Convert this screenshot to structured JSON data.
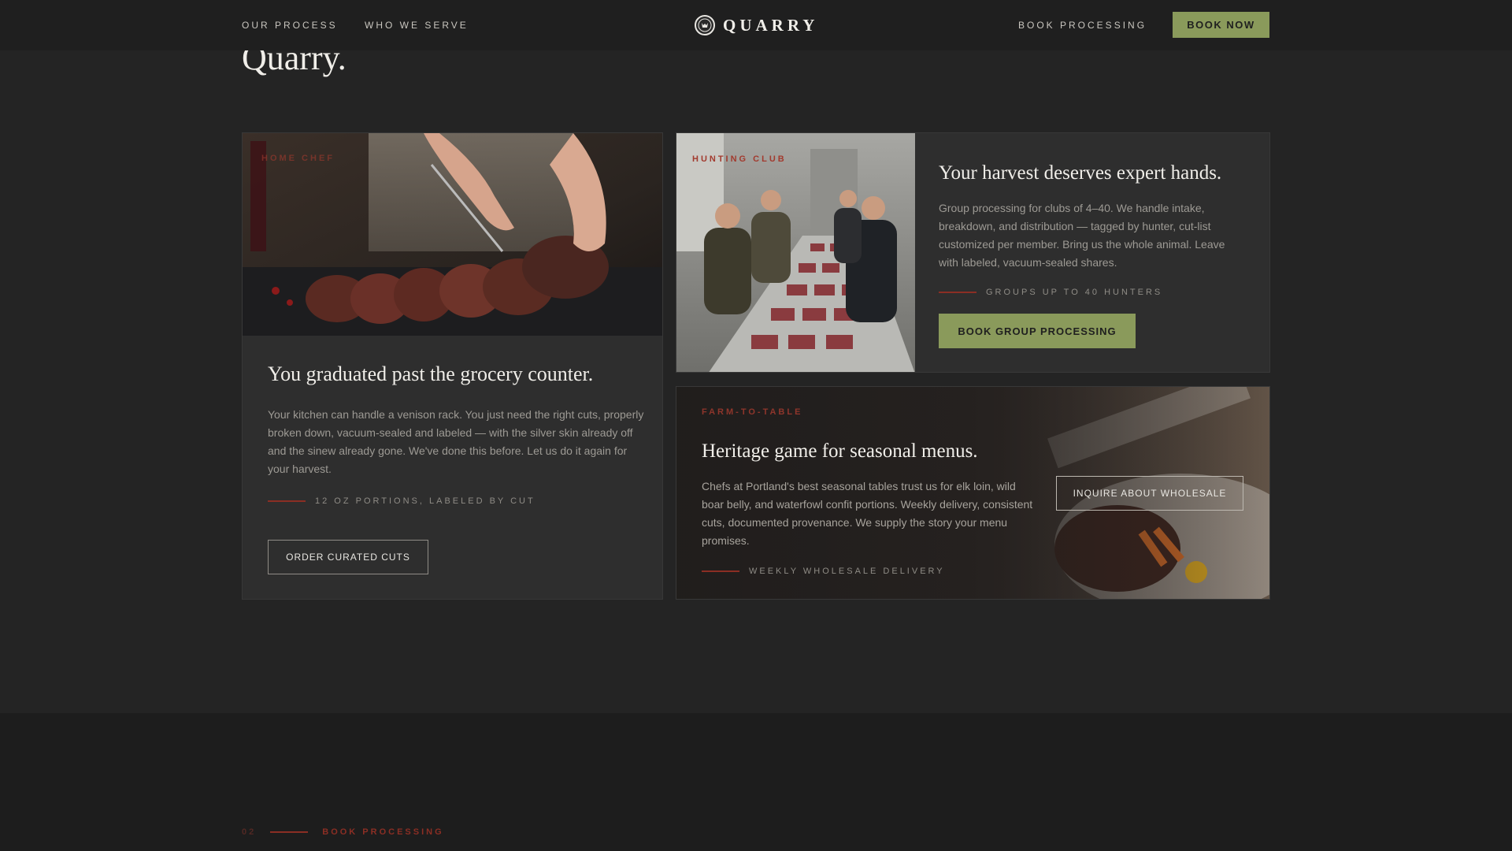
{
  "header": {
    "nav_left": [
      "OUR PROCESS",
      "WHO WE SERVE"
    ],
    "brand": "QUARRY",
    "nav_right": "BOOK PROCESSING",
    "cta": "BOOK NOW"
  },
  "intro": {
    "partial_heading": "Quarry."
  },
  "cards": {
    "home_chef": {
      "label": "HOME CHEF",
      "title": "You graduated past the grocery counter.",
      "body": "Your kitchen can handle a venison rack. You just need the right cuts, properly broken down, vacuum-sealed and labeled — with the silver skin already off and the sinew already gone. We've done this before. Let us do it again for your harvest.",
      "meta": "12 OZ PORTIONS, LABELED BY CUT",
      "button": "ORDER CURATED CUTS"
    },
    "hunting_club": {
      "label": "HUNTING CLUB",
      "title": "Your harvest deserves expert hands.",
      "body": "Group processing for clubs of 4–40. We handle intake, breakdown, and distribution — tagged by hunter, cut-list customized per member. Bring us the whole animal. Leave with labeled, vacuum-sealed shares.",
      "meta": "GROUPS UP TO 40 HUNTERS",
      "button": "BOOK GROUP PROCESSING"
    },
    "farm_to_table": {
      "label": "FARM-TO-TABLE",
      "title": "Heritage game for seasonal menus.",
      "body": "Chefs at Portland's best seasonal tables trust us for elk loin, wild boar belly, and waterfowl confit portions. Weekly delivery, consistent cuts, documented provenance. We supply the story your menu promises.",
      "meta": "WEEKLY WHOLESALE DELIVERY",
      "button": "INQUIRE ABOUT WHOLESALE"
    }
  },
  "next_section": {
    "number": "02",
    "label": "BOOK PROCESSING"
  },
  "colors": {
    "background": "#242424",
    "card": "#2e2e2e",
    "accent_green": "#8a9a5b",
    "accent_red": "#a23a2e"
  },
  "icons": {
    "logo": "deer-crest-icon"
  }
}
